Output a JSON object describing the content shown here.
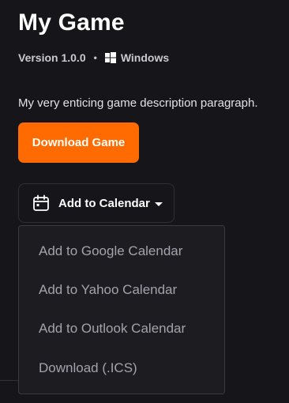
{
  "game": {
    "title": "My Game",
    "version": "Version 1.0.0",
    "separator": "•",
    "platform": "Windows",
    "platform_icon": "windows-icon",
    "description": "My very enticing game description paragraph."
  },
  "download_button": {
    "label": "Download Game",
    "color": "#ff6b00"
  },
  "calendar_button": {
    "label": "Add to Calendar",
    "icon": "calendar-icon",
    "expanded": true
  },
  "calendar_menu": {
    "items": [
      {
        "label": "Add to Google Calendar"
      },
      {
        "label": "Add to Yahoo Calendar"
      },
      {
        "label": "Add to Outlook Calendar"
      },
      {
        "label": "Download (.ICS)"
      }
    ]
  },
  "colors": {
    "background": "#16161a",
    "accent": "#ff6b00",
    "menu_text": "#a3a3ab"
  }
}
